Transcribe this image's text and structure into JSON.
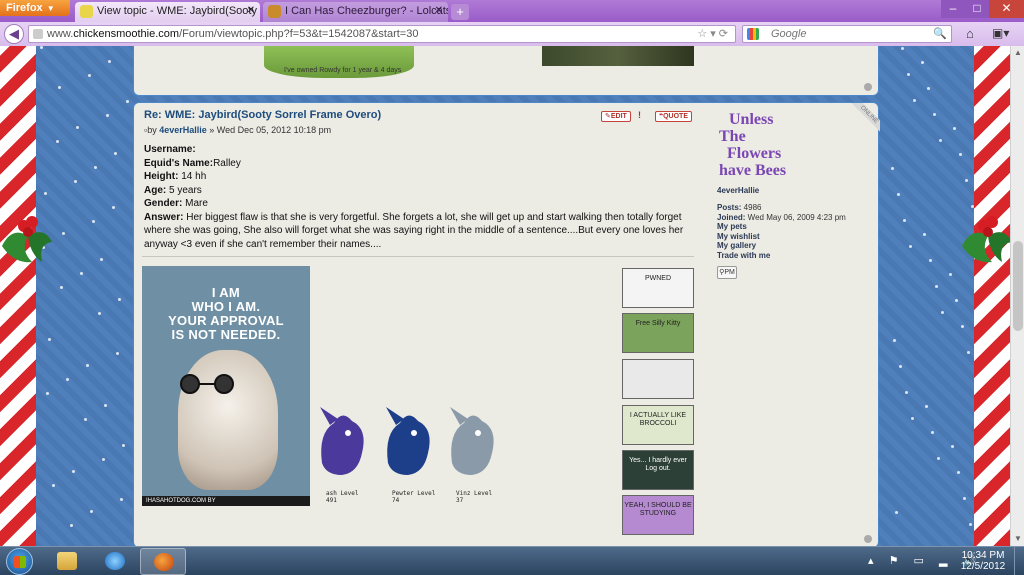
{
  "browser": {
    "app_button": "Firefox",
    "tabs": [
      {
        "label": "View topic - WME: Jaybird(Sooty Sorrel..."
      },
      {
        "label": "I Can Has Cheezburger? - Lolcats n F..."
      }
    ],
    "url_prefix": "www.",
    "url_domain": "chickensmoothie.com",
    "url_path": "/Forum/viewtopic.php?f=53&t=1542087&start=30",
    "search_placeholder": "Google"
  },
  "prev_post": {
    "signature_caption": "I've owned Rowdy for 1 year & 4 days"
  },
  "post": {
    "title": "Re: WME: Jaybird(Sooty Sorrel Frame Overo)",
    "meta_by": "by ",
    "author": "4everHallie",
    "date": " » Wed Dec 05, 2012 10:18 pm",
    "edit_label": "EDIT",
    "report_label": "!",
    "quote_label": "QUOTE",
    "fields": [
      {
        "label": "Username:",
        "value": ""
      },
      {
        "label": "Equid's Name:",
        "value": "Ralley"
      },
      {
        "label": "Height:",
        "value": " 14 hh"
      },
      {
        "label": "Age:",
        "value": " 5 years"
      },
      {
        "label": "Gender:",
        "value": " Mare"
      },
      {
        "label": "Answer:",
        "value": " Her biggest flaw is that she is very forgetful. She forgets a lot, she will get up and start walking then totally forget where she was going, She also will forget what she was saying right in the middle of a sentence....But every one loves her anyway <3 even if she can't remember their names...."
      }
    ],
    "dog_caption": [
      "I AM",
      "WHO I AM.",
      "YOUR APPROVAL",
      "IS NOT NEEDED."
    ],
    "dog_footer": "IHASAHOTDOG.COM BY",
    "pets": [
      {
        "name": "ash Level",
        "level": "491",
        "color": "#4b3a9c"
      },
      {
        "name": "Pewter Level",
        "level": "74",
        "color": "#1d3f8a"
      },
      {
        "name": "Vinz Level",
        "level": "37",
        "color": "#8a9aa8"
      }
    ],
    "badges": [
      {
        "text": "PWNED",
        "bg": "#f4f4f4"
      },
      {
        "text": "Free Silly Kitty",
        "bg": "#7ba35c"
      },
      {
        "text": "",
        "bg": "#e9e9e9"
      },
      {
        "text": "I ACTUALLY LIKE BROCCOLI",
        "bg": "#dfe8cc"
      },
      {
        "text": "Yes... I hardly ever Log out.",
        "bg": "#2d4037"
      },
      {
        "text": "YEAH, I SHOULD BE STUDYING",
        "bg": "#b58ad0"
      }
    ]
  },
  "profile": {
    "online_label": "ONLINE",
    "logo_lines": [
      "Unless",
      "The",
      "Flowers",
      "have Bees"
    ],
    "username": "4everHallie",
    "posts_label": "Posts:",
    "posts_value": " 4986",
    "joined_label": "Joined:",
    "joined_value": " Wed May 06, 2009 4:23 pm",
    "links": [
      "My pets",
      "My wishlist",
      "My gallery",
      "Trade with me"
    ],
    "pm_label": "PM"
  },
  "taskbar": {
    "time": "10:34 PM",
    "date": "12/5/2012"
  }
}
